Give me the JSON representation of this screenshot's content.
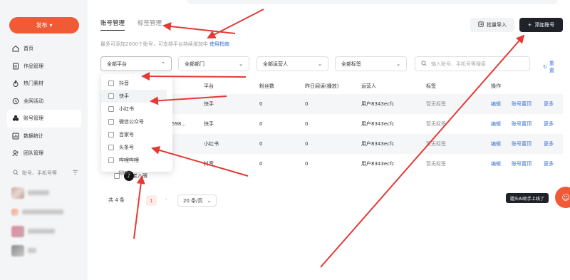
{
  "sidebar": {
    "publish_label": "发布",
    "items": [
      {
        "label": "首页",
        "icon": "home-icon",
        "active": false
      },
      {
        "label": "作品管理",
        "icon": "works-icon",
        "active": false
      },
      {
        "label": "热门素材",
        "icon": "fire-icon",
        "active": false
      },
      {
        "label": "全网活动",
        "icon": "activity-icon",
        "active": false
      },
      {
        "label": "账号管理",
        "icon": "accounts-icon",
        "active": true
      },
      {
        "label": "数据统计",
        "icon": "stats-icon",
        "active": false
      },
      {
        "label": "团队管理",
        "icon": "team-icon",
        "active": false
      }
    ],
    "search_placeholder": "账号、手机号等"
  },
  "header": {
    "tabs": [
      "账号管理",
      "标签管理"
    ],
    "hint": "最多可添加2000个账号，可支持平台持续增加中",
    "hint_link": "使用指南",
    "import_label": "批量导入",
    "add_label": "添加账号"
  },
  "filters": {
    "platform": "全部平台",
    "department": "全部部门",
    "operator": "全部运营人",
    "tag": "全部标签",
    "search_placeholder": "输入账号、手机号等搜索",
    "reset_label": "重置"
  },
  "dropdown": {
    "options": [
      "抖音",
      "快手",
      "小红书",
      "微信公众号",
      "百家号",
      "头条号",
      "哔哩哔哩",
      "视频号"
    ]
  },
  "table": {
    "headers": [
      "平台",
      "粉丝数",
      "昨日阅读(播放)",
      "运营人",
      "标签",
      "操作"
    ],
    "rows": [
      {
        "account": "",
        "platform": "快手",
        "fans": "0",
        "views": "0",
        "operator": "用户8343ecfc",
        "tag": "暂无标签"
      },
      {
        "account": "598...",
        "platform": "快手",
        "fans": "0",
        "views": "0",
        "operator": "用户8343ecfc",
        "tag": "暂无标签"
      },
      {
        "account": "",
        "platform": "小红书",
        "fans": "0",
        "views": "0",
        "operator": "用户8343ecfc",
        "tag": "暂无标签"
      },
      {
        "account": "老八眼",
        "platform": "抖音",
        "fans": "0",
        "views": "0",
        "operator": "用户8343ecfc",
        "tag": "暂无标签"
      }
    ],
    "actions": [
      "编辑",
      "账号置顶",
      "更多"
    ]
  },
  "pager": {
    "total": "共 4 条",
    "page": "1",
    "page_size": "20 条/页"
  },
  "ai_helper": {
    "bubble": "疆头AI助手上线了"
  },
  "colors": {
    "accent": "#f05a37",
    "link": "#3a6fd8",
    "dark": "#1f2329",
    "annotation": "#e53935"
  }
}
